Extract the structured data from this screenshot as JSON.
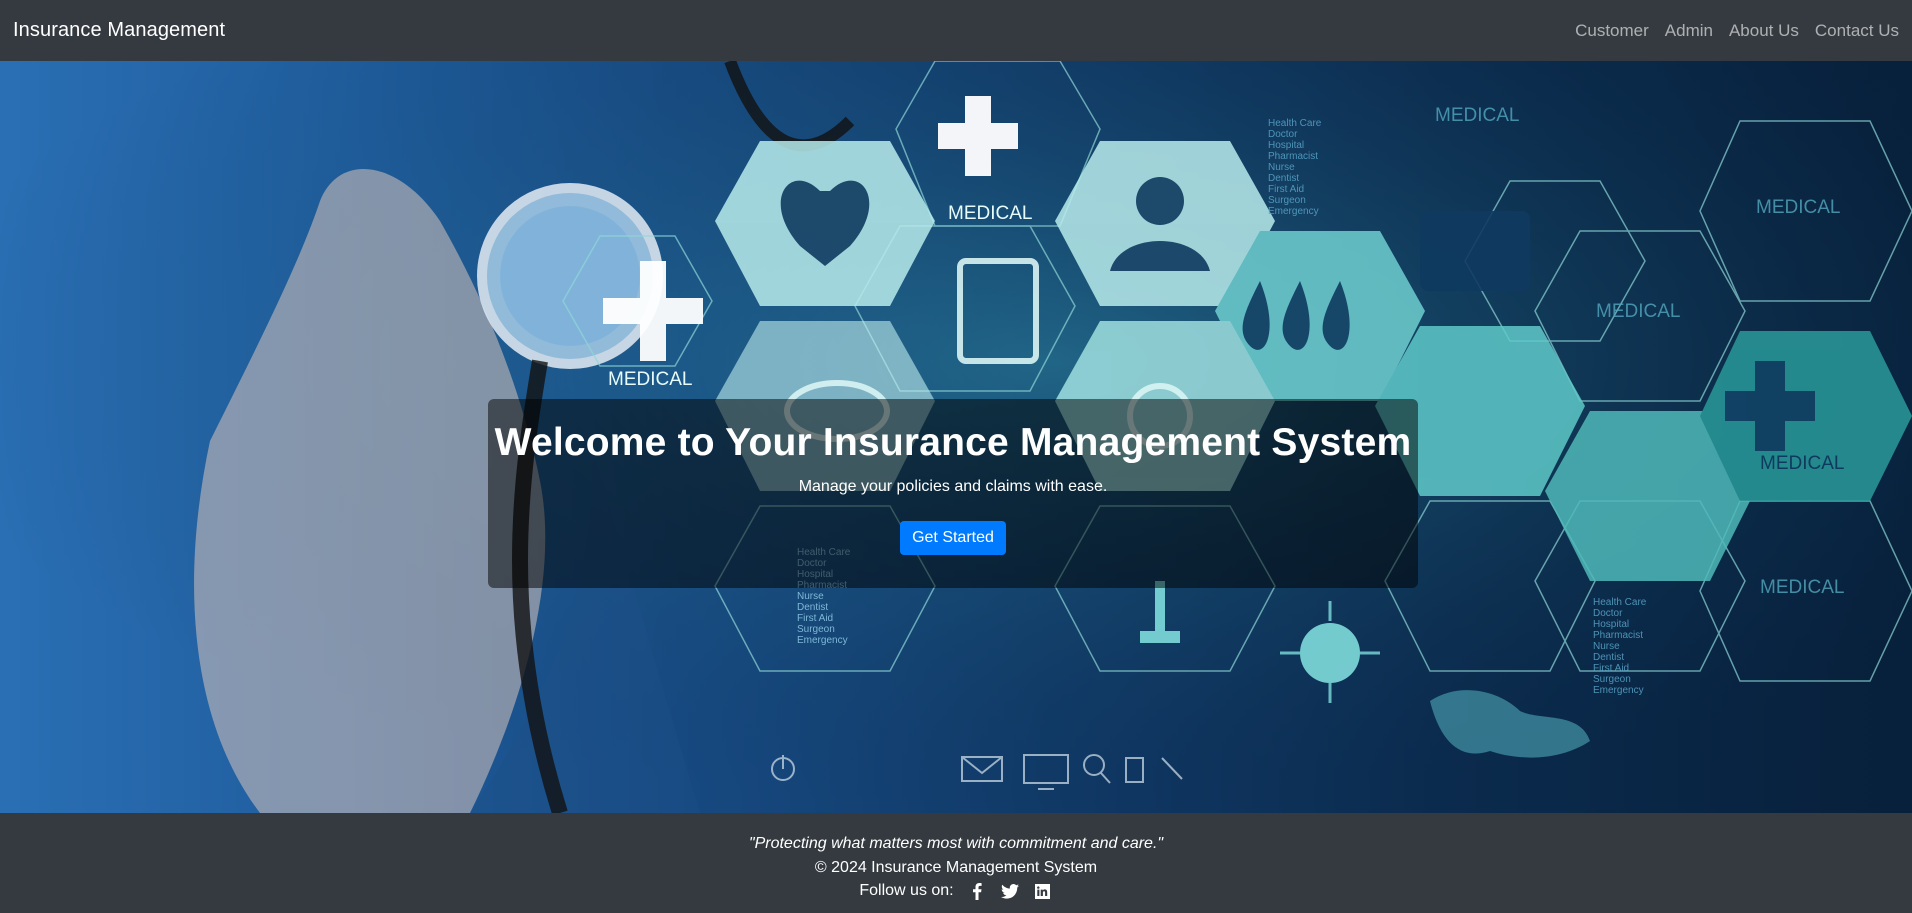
{
  "navbar": {
    "brand": "Insurance Management",
    "links": [
      "Customer",
      "Admin",
      "About Us",
      "Contact Us"
    ]
  },
  "hero": {
    "title": "Welcome to Your Insurance Management System",
    "subtitle": "Manage your policies and claims with ease.",
    "cta_label": "Get Started",
    "art_labels": {
      "medical": "MEDICAL",
      "list": [
        "Health Care",
        "Doctor",
        "Hospital",
        "Pharmacist",
        "Nurse",
        "Dentist",
        "First Aid",
        "Surgeon",
        "Emergency"
      ]
    }
  },
  "footer": {
    "tagline": "\"Protecting what matters most with commitment and care.\"",
    "copyright": "© 2024 Insurance Management System",
    "follow_label": "Follow us on:",
    "social_icons": [
      "facebook-icon",
      "twitter-icon",
      "linkedin-icon"
    ]
  },
  "colors": {
    "navbar_bg": "#343a40",
    "primary_button": "#007bff",
    "hero_teal": "#5fc9c9"
  }
}
